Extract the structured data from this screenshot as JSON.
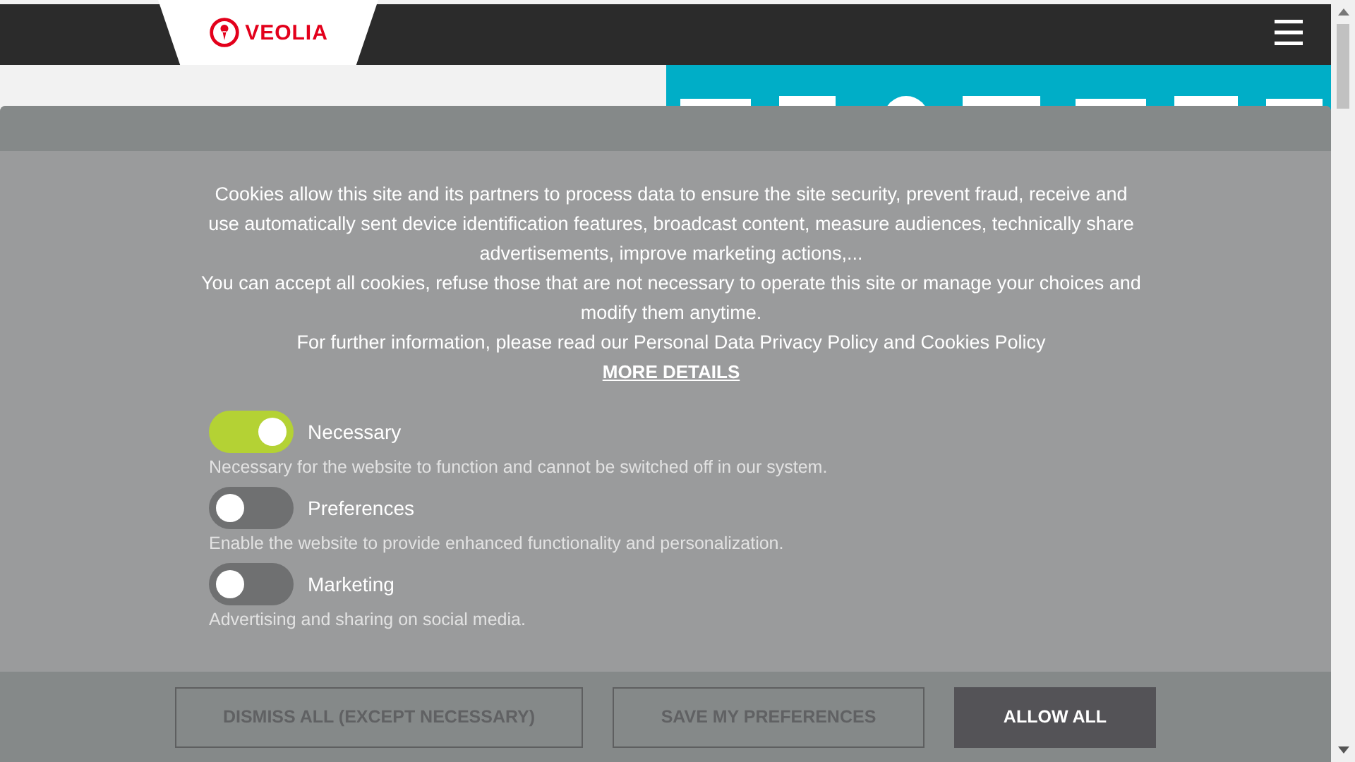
{
  "header": {
    "logo": "VEOLIA"
  },
  "cookie_banner": {
    "paragraphs": [
      "Cookies allow this site and its partners to process data to ensure the site security, prevent fraud, receive and use automatically sent device identification features, broadcast content, measure audiences, technically share advertisements, improve marketing actions,...",
      "You can accept all cookies, refuse those that are not necessary to operate this site or manage your choices and modify them anytime.",
      "For further information, please read our Personal Data Privacy Policy and Cookies Policy"
    ],
    "more_details": "MORE DETAILS",
    "categories": [
      {
        "name": "Necessary",
        "on": true,
        "description": "Necessary for the website to function and cannot be switched off in our system."
      },
      {
        "name": "Preferences",
        "on": false,
        "description": "Enable the website to provide enhanced functionality and personalization."
      },
      {
        "name": "Marketing",
        "on": false,
        "description": "Advertising and sharing on social media."
      }
    ],
    "buttons": [
      {
        "label": "DISMISS ALL (EXCEPT NECESSARY)",
        "kind": "outline"
      },
      {
        "label": "SAVE MY PREFERENCES",
        "kind": "outline"
      },
      {
        "label": "ALLOW ALL",
        "kind": "primary"
      }
    ]
  }
}
